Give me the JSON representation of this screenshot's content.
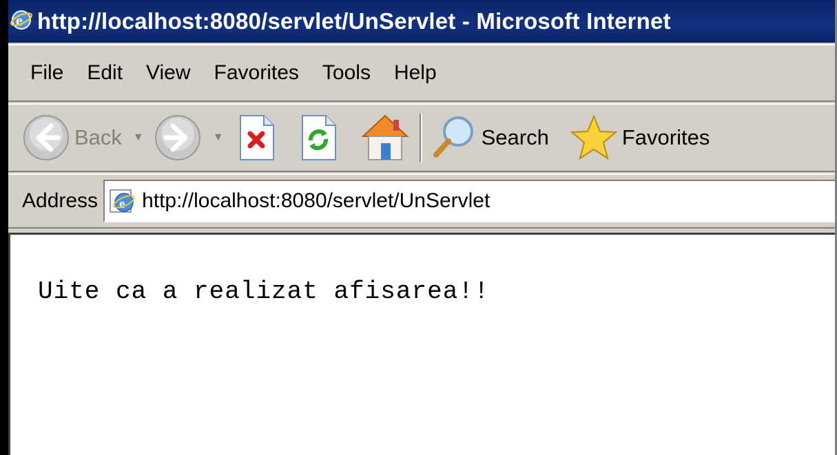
{
  "window": {
    "title": "http://localhost:8080/servlet/UnServlet - Microsoft Internet"
  },
  "menu": {
    "items": [
      "File",
      "Edit",
      "View",
      "Favorites",
      "Tools",
      "Help"
    ]
  },
  "toolbar": {
    "back_label": "Back",
    "search_label": "Search",
    "favorites_label": "Favorites"
  },
  "address": {
    "label": "Address",
    "url": "http://localhost:8080/servlet/UnServlet"
  },
  "page": {
    "text": "Uite ca a realizat afisarea!!"
  },
  "colors": {
    "titlebar": "#0a246a",
    "chrome": "#d4d0c8"
  }
}
